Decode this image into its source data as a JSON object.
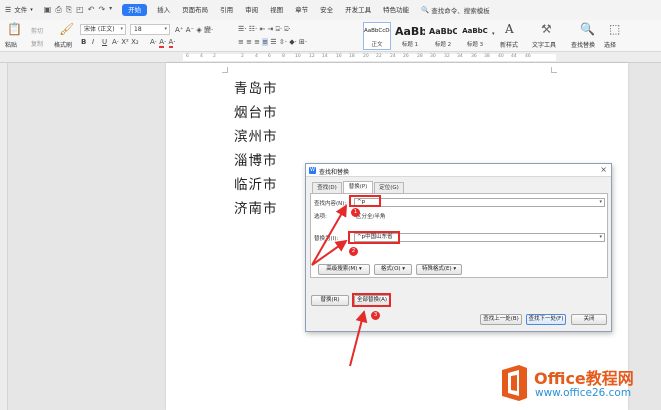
{
  "menubar": {
    "file": "文件",
    "tabs": [
      "开始",
      "插入",
      "页面布局",
      "引用",
      "审阅",
      "视图",
      "章节",
      "安全",
      "开发工具",
      "特色功能"
    ],
    "active_tab": "开始",
    "search_placeholder": "查找命令、搜索模板"
  },
  "ribbon": {
    "paste": "粘贴",
    "cut": "剪切",
    "copy": "复制",
    "format_painter": "格式刷",
    "font_name": "宋体 (正文)",
    "font_size": "18",
    "styles": [
      {
        "preview": "AaBbCcDd",
        "name": "正文"
      },
      {
        "preview": "AaBb",
        "name": "标题 1"
      },
      {
        "preview": "AaBbC",
        "name": "标题 2"
      },
      {
        "preview": "AaBbC",
        "name": "标题 3"
      }
    ],
    "new_style": "新样式",
    "text_tools": "文字工具",
    "find_replace": "查找替换",
    "select": "选择"
  },
  "ruler": {
    "ticks": [
      "6",
      "4",
      "2",
      "2",
      "4",
      "6",
      "8",
      "10",
      "12",
      "14",
      "16",
      "18",
      "20",
      "22",
      "24",
      "26",
      "28",
      "30",
      "32",
      "34",
      "36",
      "38",
      "40",
      "44",
      "46"
    ]
  },
  "document": {
    "lines": [
      "青岛市",
      "烟台市",
      "滨州市",
      "淄博市",
      "临沂市",
      "济南市"
    ]
  },
  "dialog": {
    "title": "查找和替换",
    "tabs": [
      "查找(D)",
      "替换(P)",
      "定位(G)"
    ],
    "active_tab": "替换(P)",
    "find_label": "查找内容(N):",
    "find_value": "^p",
    "options_label": "选项:",
    "options_value": "区分全/半角",
    "replace_label": "替换为(I):",
    "replace_value": "^p中国山东省",
    "advanced_search": "高级搜索(M)",
    "format_button": "格式(O)",
    "special_format": "特殊格式(E)",
    "replace_button": "替换(R)",
    "replace_all_button": "全部替换(A)",
    "find_prev": "查找上一处(B)",
    "find_next": "查找下一处(F)",
    "close": "关闭"
  },
  "annotations": {
    "badges": [
      "1",
      "2",
      "3"
    ],
    "color": "#e52a2a"
  },
  "watermark": {
    "brand": "Office教程网",
    "url": "www.office26.com"
  },
  "colors": {
    "accent": "#2b79f5",
    "annotation": "#e52a2a",
    "brand_orange": "#e45b1c",
    "url_blue": "#2b8fd6"
  }
}
